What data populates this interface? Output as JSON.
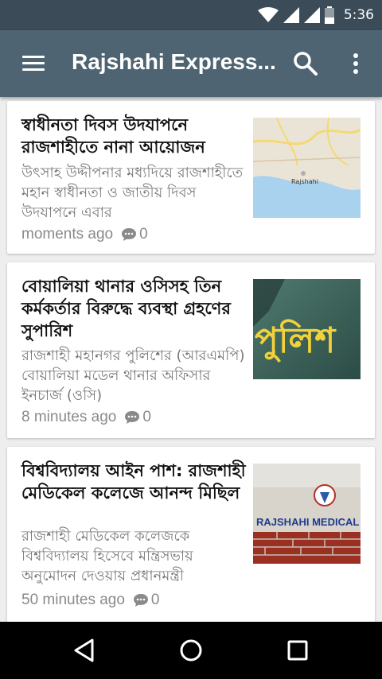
{
  "status_bar": {
    "time": "5:36",
    "icons": [
      "wifi-icon",
      "signal-icon",
      "signal-icon",
      "battery-icon"
    ]
  },
  "app_bar": {
    "title": "Rajshahi Express...",
    "icons": [
      "menu-icon",
      "search-icon",
      "more-vert-icon"
    ]
  },
  "articles": [
    {
      "title": "স্বাধীনতা দিবস উদযাপনে রাজশাহীতে নানা আয়োজন",
      "summary": "উৎসাহ উদ্দীপনার মধ্যদিয়ে রাজশাহীতে মহান স্বাধীনতা ও জাতীয় দিবস উদযাপনে এবার",
      "time": "moments ago",
      "comments": "0",
      "thumb_label": "Rajshahi"
    },
    {
      "title": "বোয়ালিয়া থানার ওসিসহ তিন কর্মকর্তার বিরুদ্ধে ব্যবস্থা গ্রহণের সুপারিশ",
      "summary": "রাজশাহী মহানগর পুলিশের (আরএমপি) বোয়ালিয়া মডেল থানার অফিসার ইনচার্জ (ওসি)",
      "time": "8 minutes ago",
      "comments": "0",
      "thumb_label": "পুলিশ"
    },
    {
      "title": "বিশ্ববিদ্যালয় আইন পাশ: রাজশাহী মেডিকেল কলেজে আনন্দ মিছিল",
      "summary": "রাজশাহী মেডিকেল কলেজকে বিশ্ববিদ্যালয় হিসেবে মন্ত্রিসভায় অনুমোদন দেওয়ায় প্রধানমন্ত্রী",
      "time": "50 minutes ago",
      "comments": "0",
      "thumb_label": "RAJSHAHI MEDICAL COL"
    }
  ],
  "nav_bar": {
    "icons": [
      "back-icon",
      "home-icon",
      "recents-icon"
    ]
  },
  "colors": {
    "status_bar": "#3b4c58",
    "app_bar": "#4e6472",
    "background": "#eeeeee",
    "card": "#ffffff",
    "nav_bar": "#000000"
  }
}
